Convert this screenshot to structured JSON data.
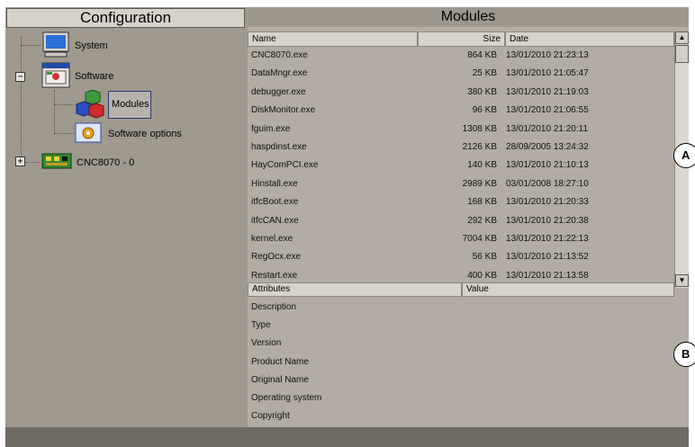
{
  "config_panel": {
    "title": "Configuration",
    "tree": {
      "system": "System",
      "software": "Software",
      "modules": "Modules",
      "software_options": "Software options",
      "cnc": "CNC8070 - 0"
    },
    "icons": {
      "system": "monitor-icon",
      "software": "software-window-icon",
      "modules": "cubes-icon",
      "software_options": "options-gear-icon",
      "cnc": "circuit-board-icon"
    }
  },
  "modules_panel": {
    "title": "Modules",
    "columns": {
      "name": "Name",
      "size": "Size",
      "date": "Date"
    },
    "rows": [
      {
        "name": "CNC8070.exe",
        "size": "864 KB",
        "date": "13/01/2010  21:23:13"
      },
      {
        "name": "DataMngr.exe",
        "size": "25 KB",
        "date": "13/01/2010  21:05:47"
      },
      {
        "name": "debugger.exe",
        "size": "380 KB",
        "date": "13/01/2010  21:19:03"
      },
      {
        "name": "DiskMonitor.exe",
        "size": "96 KB",
        "date": "13/01/2010  21:06:55"
      },
      {
        "name": "fguim.exe",
        "size": "1308 KB",
        "date": "13/01/2010  21:20:11"
      },
      {
        "name": "haspdinst.exe",
        "size": "2126 KB",
        "date": "28/09/2005  13:24:32"
      },
      {
        "name": "HayComPCI.exe",
        "size": "140 KB",
        "date": "13/01/2010  21:10:13"
      },
      {
        "name": "Hinstall.exe",
        "size": "2989 KB",
        "date": "03/01/2008  18:27:10"
      },
      {
        "name": "itfcBoot.exe",
        "size": "168 KB",
        "date": "13/01/2010  21:20:33"
      },
      {
        "name": "itfcCAN.exe",
        "size": "292 KB",
        "date": "13/01/2010  21:20:38"
      },
      {
        "name": "kernel.exe",
        "size": "7004 KB",
        "date": "13/01/2010  21:22:13"
      },
      {
        "name": "RegOcx.exe",
        "size": "56 KB",
        "date": "13/01/2010  21:13:52"
      },
      {
        "name": "Restart.exe",
        "size": "400 KB",
        "date": "13/01/2010  21:13:58"
      }
    ],
    "attr_columns": {
      "attributes": "Attributes",
      "value": "Value"
    },
    "attributes": [
      "Description",
      "Type",
      "Version",
      "Product Name",
      "Original Name",
      "Operating system",
      "Copyright"
    ],
    "scroll_up": "▲",
    "scroll_down": "▼"
  },
  "callouts": {
    "a": "A",
    "b": "B"
  }
}
